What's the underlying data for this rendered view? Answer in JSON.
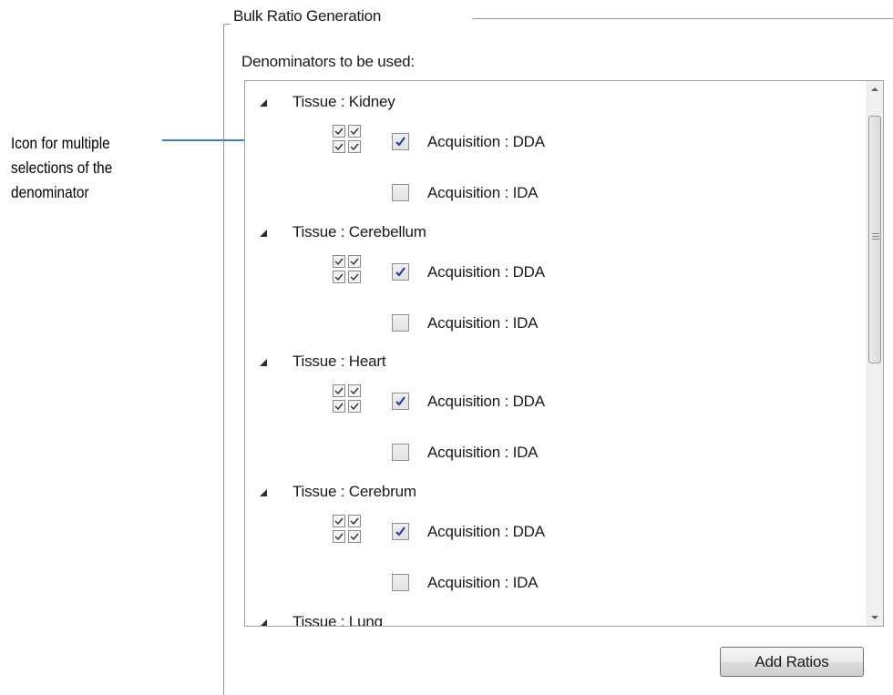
{
  "callout": {
    "text": "Icon for multiple\nselections of the\ndenominator"
  },
  "group": {
    "title": "Bulk Ratio Generation"
  },
  "denominators": {
    "label": "Denominators to be used:",
    "tissues": [
      {
        "label": "Tissue : Kidney",
        "options": [
          {
            "label": "Acquisition : DDA",
            "checked": true
          },
          {
            "label": "Acquisition : IDA",
            "checked": false
          }
        ]
      },
      {
        "label": "Tissue : Cerebellum",
        "options": [
          {
            "label": "Acquisition : DDA",
            "checked": true
          },
          {
            "label": "Acquisition : IDA",
            "checked": false
          }
        ]
      },
      {
        "label": "Tissue : Heart",
        "options": [
          {
            "label": "Acquisition : DDA",
            "checked": true
          },
          {
            "label": "Acquisition : IDA",
            "checked": false
          }
        ]
      },
      {
        "label": "Tissue : Cerebrum",
        "options": [
          {
            "label": "Acquisition : DDA",
            "checked": true
          },
          {
            "label": "Acquisition : IDA",
            "checked": false
          }
        ]
      },
      {
        "label": "Tissue : Lung"
      }
    ]
  },
  "actions": {
    "add_ratios_label": "Add Ratios"
  },
  "colors": {
    "callout_line": "#3b7fc8",
    "check_mark": "#2b3f9c"
  }
}
